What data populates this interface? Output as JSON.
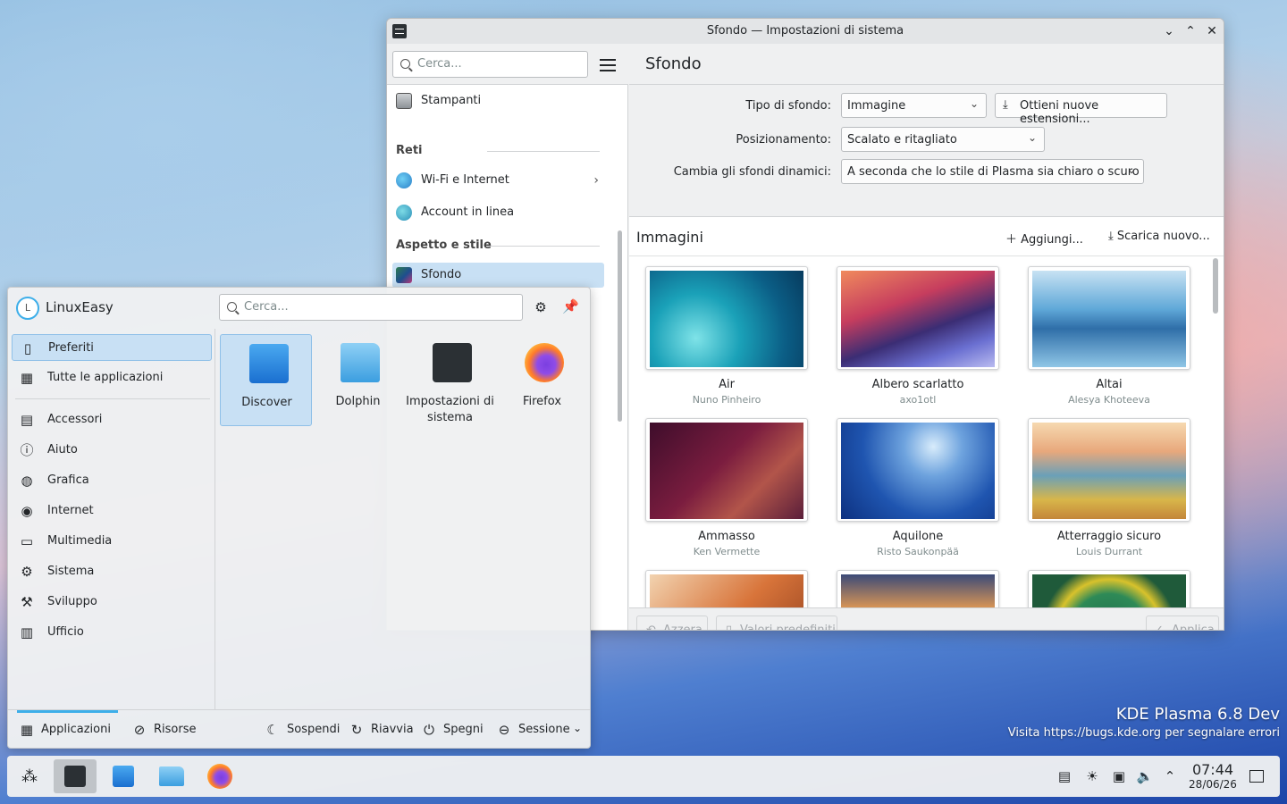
{
  "window": {
    "title": "Sfondo — Impostazioni di sistema"
  },
  "sidebar": {
    "search_placeholder": "Cerca...",
    "items": [
      {
        "label": "Stampanti"
      },
      {
        "section": "Reti"
      },
      {
        "label": "Wi-Fi e Internet"
      },
      {
        "label": "Account in linea"
      },
      {
        "section": "Aspetto e stile"
      },
      {
        "label": "Sfondo"
      }
    ]
  },
  "page": {
    "title": "Sfondo",
    "fields": {
      "tipo_label": "Tipo di sfondo:",
      "tipo_value": "Immagine",
      "estensioni_button": "Ottieni nuove estensioni...",
      "pos_label": "Posizionamento:",
      "pos_value": "Scalato e ritagliato",
      "din_label": "Cambia gli sfondi dinamici:",
      "din_value": "A seconda che lo stile di Plasma sia chiaro o scuro"
    },
    "images_title": "Immagini",
    "add_button": "Aggiungi...",
    "download_button": "Scarica nuovo...",
    "wallpapers": [
      {
        "name": "Air",
        "author": "Nuno Pinheiro"
      },
      {
        "name": "Albero scarlatto",
        "author": "axo1otl"
      },
      {
        "name": "Altai",
        "author": "Alesya Khoteeva"
      },
      {
        "name": "Ammasso",
        "author": "Ken Vermette"
      },
      {
        "name": "Aquilone",
        "author": "Risto Saukonpää"
      },
      {
        "name": "Atterraggio sicuro",
        "author": "Louis Durrant"
      }
    ],
    "footer": {
      "reset": "Azzera",
      "defaults": "Valori predefiniti",
      "apply": "Applica"
    }
  },
  "launcher": {
    "user": "LinuxEasy",
    "avatar_letter": "L",
    "search_placeholder": "Cerca...",
    "categories": [
      "Preferiti",
      "Tutte le applicazioni",
      "Accessori",
      "Aiuto",
      "Grafica",
      "Internet",
      "Multimedia",
      "Sistema",
      "Sviluppo",
      "Ufficio"
    ],
    "apps": [
      {
        "name": "Discover"
      },
      {
        "name": "Dolphin"
      },
      {
        "name": "Impostazioni di sistema"
      },
      {
        "name": "Firefox"
      }
    ],
    "footer": {
      "applications": "Applicazioni",
      "resources": "Risorse",
      "suspend": "Sospendi",
      "restart": "Riavvia",
      "shutdown": "Spegni",
      "session": "Sessione"
    }
  },
  "taskbar": {
    "time": "07:44",
    "date": "28/06/26"
  },
  "desktop": {
    "watermark_title": "KDE Plasma 6.8 Dev",
    "watermark_text": "Visita https://bugs.kde.org per segnalare errori"
  },
  "colors": {
    "accent": "#3daee9",
    "selection": "#c8e0f4"
  }
}
